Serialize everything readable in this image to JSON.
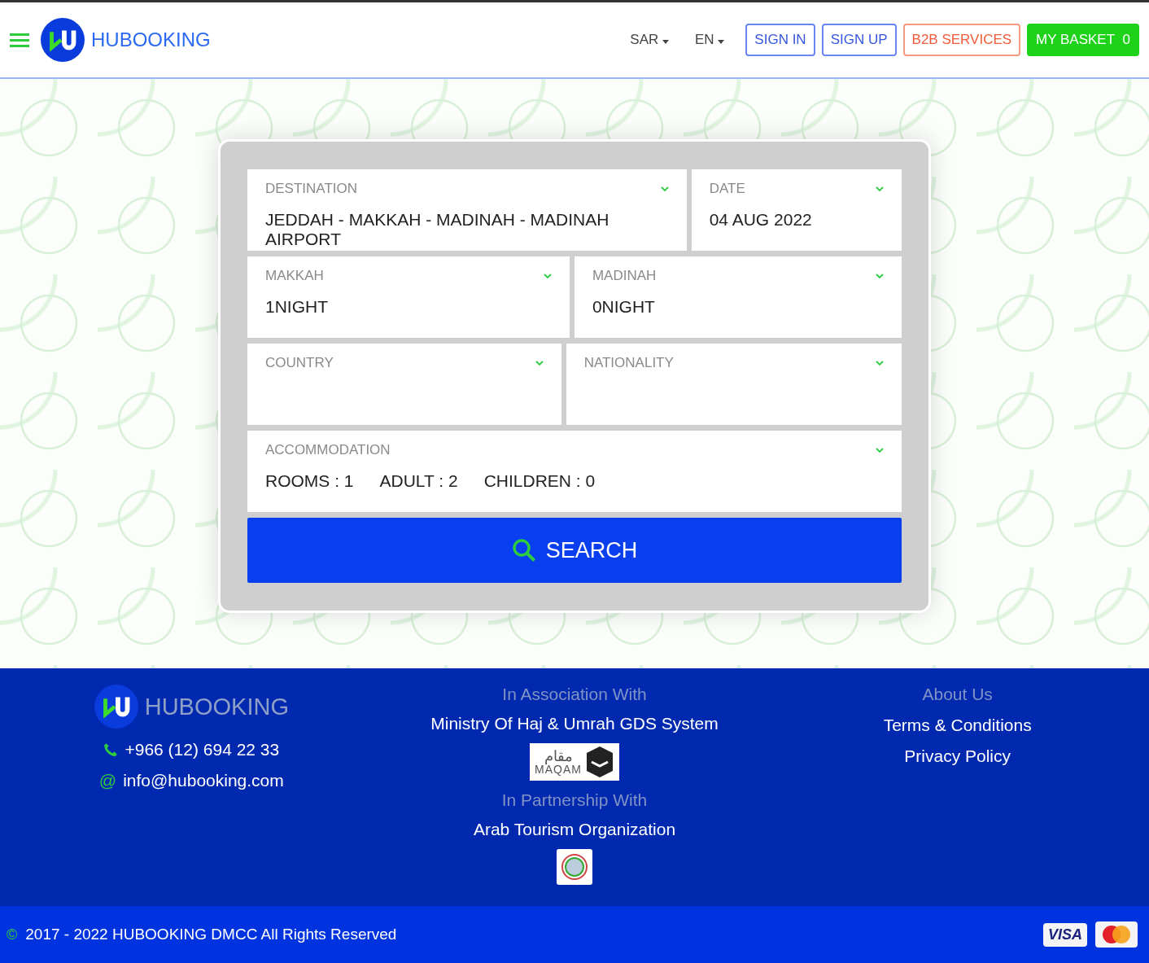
{
  "header": {
    "brand": "HUBOOKING",
    "currency": "SAR",
    "language": "EN",
    "buttons": [
      {
        "label": "SIGN IN",
        "kind": "outline-blue"
      },
      {
        "label": "SIGN UP",
        "kind": "outline-blue"
      },
      {
        "label": "B2B SERVICES",
        "kind": "outline-orange"
      },
      {
        "label": "MY BASKET",
        "kind": "basket",
        "count": "0"
      }
    ]
  },
  "search_form": {
    "rows": [
      [
        {
          "label": "DESTINATION",
          "value": "JEDDAH - MAKKAH - MADINAH - MADINAH AIRPORT"
        },
        {
          "label": "DATE",
          "value": "04 AUG 2022"
        }
      ],
      [
        {
          "label": "MAKKAH",
          "value": "1NIGHT"
        },
        {
          "label": "MADINAH",
          "value": "0NIGHT"
        }
      ],
      [
        {
          "label": "COUNTRY"
        },
        {
          "label": "NATIONALITY"
        }
      ]
    ],
    "accommodation": {
      "label": "ACCOMMODATION",
      "items": [
        "ROOMS : 1",
        "ADULT : 2",
        "CHILDREN : 0"
      ]
    },
    "search_button": "SEARCH"
  },
  "footer": {
    "brand": "HUBOOKING",
    "phone": "+966 (12) 694 22 33",
    "email_icon": "@",
    "email": "info@hubooking.com",
    "association": {
      "heading": "In Association With",
      "name": "Ministry Of Haj & Umrah GDS System",
      "logo_arabic": "مقام",
      "logo_latin": "MAQAM"
    },
    "partnership": {
      "heading": "In Partnership With",
      "name": "Arab Tourism Organization"
    },
    "links": [
      "About Us",
      "Terms & Conditions",
      "Privacy Policy"
    ],
    "copyright_icon": "©",
    "copyright": "2017 - 2022 HUBOOKING DMCC All Rights Reserved",
    "card_logo": "VISA"
  }
}
